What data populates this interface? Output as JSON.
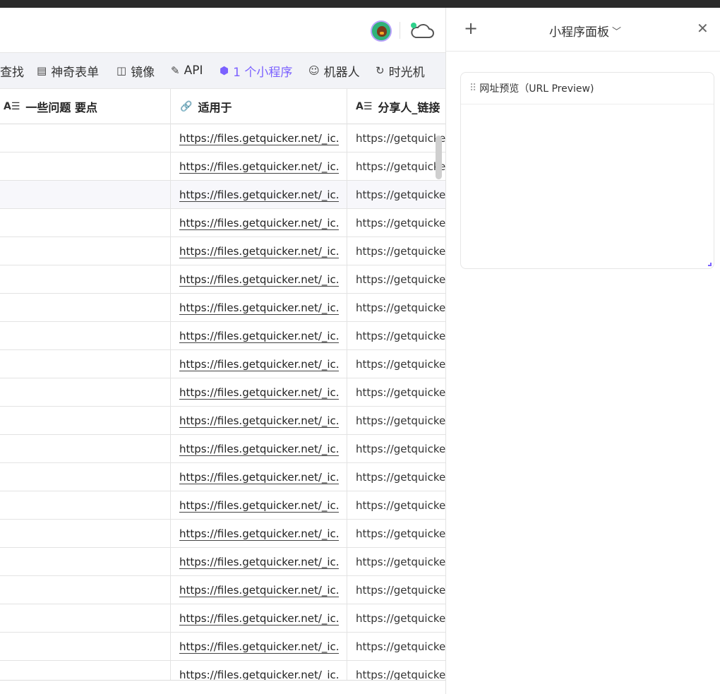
{
  "toolbar": {
    "items": [
      {
        "label": "查找",
        "icon": "search-icon"
      },
      {
        "label": "神奇表单",
        "icon": "form-icon"
      },
      {
        "label": "镜像",
        "icon": "mirror-icon"
      },
      {
        "label": "API",
        "icon": "api-icon"
      },
      {
        "label": "1 个小程序",
        "icon": "cube-icon",
        "active": true
      },
      {
        "label": "机器人",
        "icon": "robot-icon"
      },
      {
        "label": "时光机",
        "icon": "history-icon"
      }
    ],
    "active_color": "#7b61ff"
  },
  "grid": {
    "columns": [
      {
        "label": "一些问题 要点",
        "icon": "text-field-icon"
      },
      {
        "label": "适用于",
        "icon": "link-icon"
      },
      {
        "label": "分享人_链接",
        "icon": "text-field-icon"
      }
    ],
    "rows": [
      {
        "url": "https://files.getquicker.net/_ic...",
        "share": "https://getquicker"
      },
      {
        "url": "https://files.getquicker.net/_ic...",
        "share": "https://getquicker"
      },
      {
        "url": "https://files.getquicker.net/_ic...",
        "share": "https://getquicker"
      },
      {
        "url": "https://files.getquicker.net/_ic...",
        "share": "https://getquicker"
      },
      {
        "url": "https://files.getquicker.net/_ic...",
        "share": "https://getquicker"
      },
      {
        "url": "https://files.getquicker.net/_ic...",
        "share": "https://getquicker"
      },
      {
        "url": "https://files.getquicker.net/_ic...",
        "share": "https://getquicker"
      },
      {
        "url": "https://files.getquicker.net/_ic...",
        "share": "https://getquicker"
      },
      {
        "url": "https://files.getquicker.net/_ic...",
        "share": "https://getquicker"
      },
      {
        "url": "https://files.getquicker.net/_ic...",
        "share": "https://getquicker"
      },
      {
        "url": "https://files.getquicker.net/_ic...",
        "share": "https://getquicker"
      },
      {
        "url": "https://files.getquicker.net/_ic...",
        "share": "https://getquicker"
      },
      {
        "url": "https://files.getquicker.net/_ic...",
        "share": "https://getquicker"
      },
      {
        "url": "https://files.getquicker.net/_ic...",
        "share": "https://getquicker"
      },
      {
        "url": "https://files.getquicker.net/_ic...",
        "share": "https://getquicker"
      },
      {
        "url": "https://files.getquicker.net/_ic...",
        "share": "https://getquicker"
      },
      {
        "url": "https://files.getquicker.net/_ic...",
        "share": "https://getquicker"
      },
      {
        "url": "https://files.getquicker.net/_ic...",
        "share": "https://getquicker"
      },
      {
        "url": "https://files.getquicker.net/_ic...",
        "share": "https://getquicker"
      },
      {
        "url": "https://files.getquicker.net/_ic...",
        "share": "https://getquicker"
      }
    ]
  },
  "panel": {
    "title": "小程序面板",
    "widget": {
      "title": "网址预览（URL Preview)"
    }
  }
}
